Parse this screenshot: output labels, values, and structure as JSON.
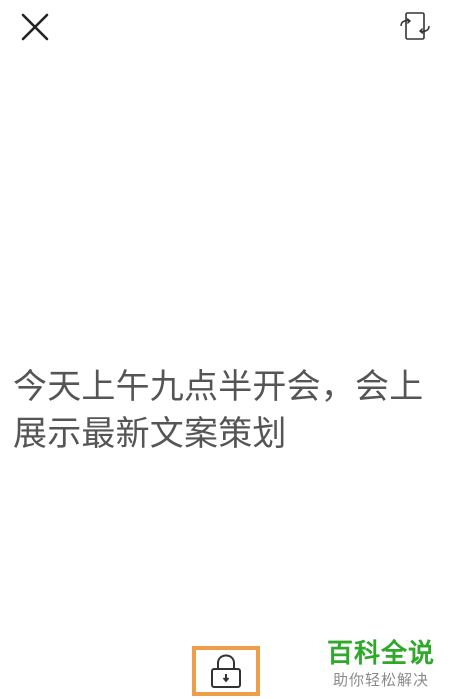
{
  "toolbar": {
    "close_icon": "close-icon",
    "rotate_icon": "rotate-screen-icon"
  },
  "content": {
    "message": "今天上午九点半开会，会上展示最新文案策划"
  },
  "bottom": {
    "lock_icon": "lock-icon",
    "highlight_color": "#ee9d49"
  },
  "watermark": {
    "title": "百科全说",
    "subtitle": "助你轻松解决",
    "title_color": "#2fa82b"
  }
}
